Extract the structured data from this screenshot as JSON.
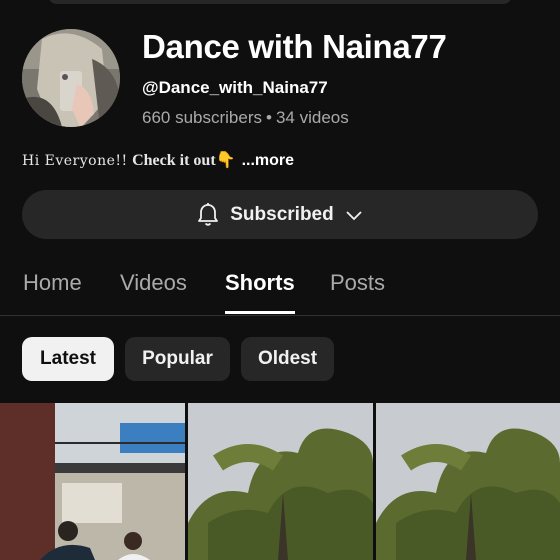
{
  "channel": {
    "name": "Dance with Naina77",
    "handle": "@Dance_with_Naina77",
    "subscribers": "660 subscribers",
    "separator": "•",
    "videos": "34 videos",
    "description_part1": "Hi Everyone!!",
    "description_part2": "Check it out",
    "description_emoji": "👇",
    "description_more": "...more"
  },
  "subscribe_button": {
    "label": "Subscribed",
    "icon": "bell-icon",
    "chevron": "chevron-down-icon"
  },
  "tabs": [
    {
      "label": "Home",
      "active": false
    },
    {
      "label": "Videos",
      "active": false
    },
    {
      "label": "Shorts",
      "active": true
    },
    {
      "label": "Posts",
      "active": false
    }
  ],
  "filters": [
    {
      "label": "Latest",
      "selected": true
    },
    {
      "label": "Popular",
      "selected": false
    },
    {
      "label": "Oldest",
      "selected": false
    }
  ],
  "colors": {
    "background": "#0f0f0f",
    "surface": "#272727",
    "text_secondary": "#aaaaaa",
    "chip_selected": "#f1f1f1"
  }
}
